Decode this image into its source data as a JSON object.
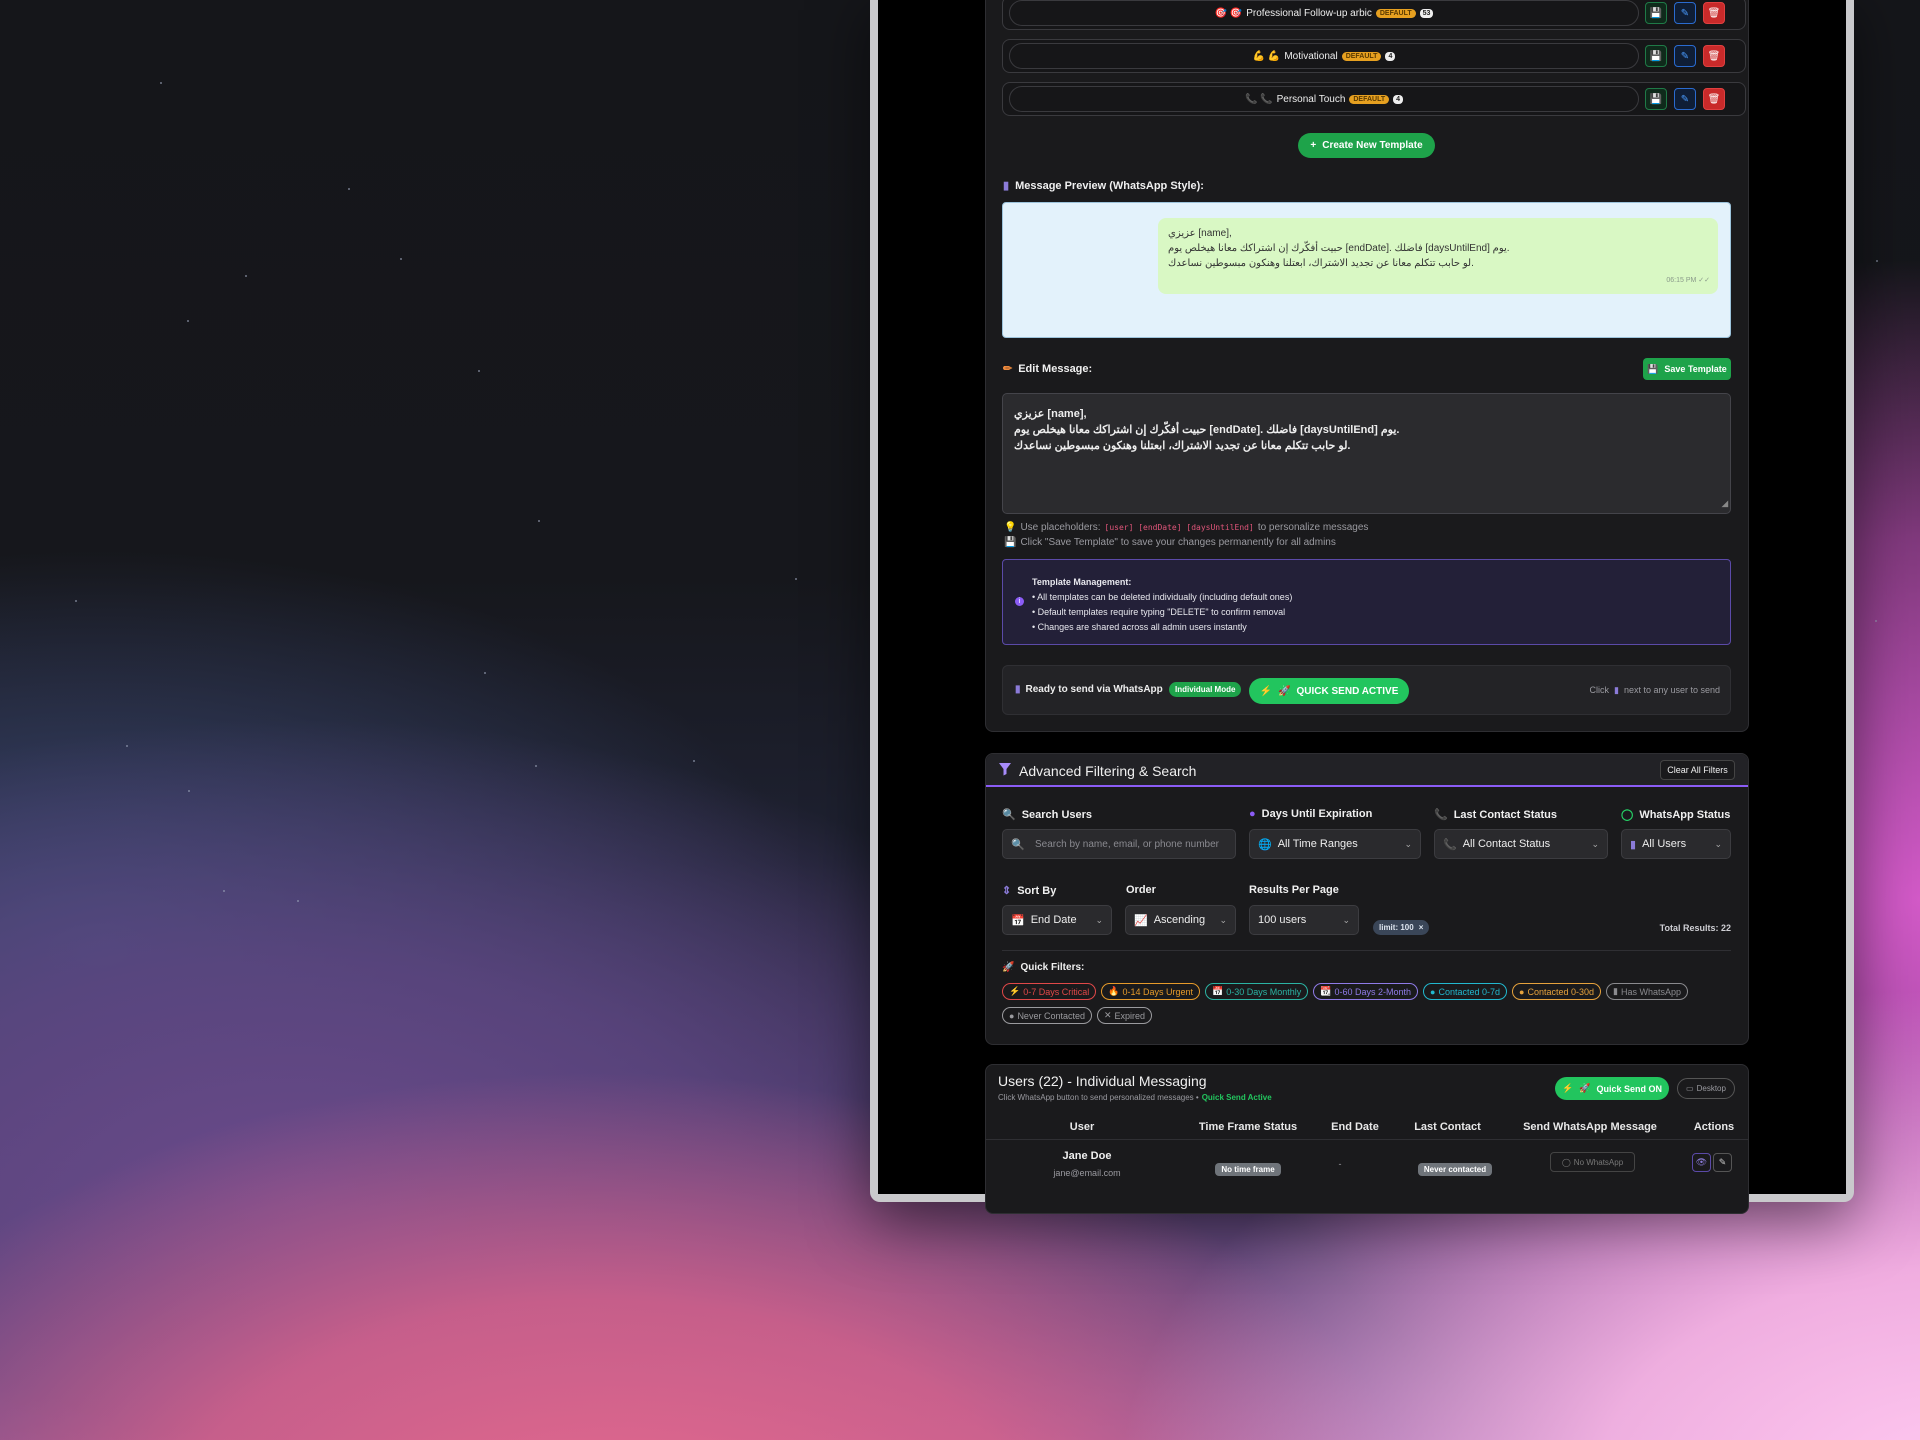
{
  "templates": [
    {
      "icon": "🎯 🎯",
      "name": "Professional Follow-up arbic",
      "badge": "DEFAULT",
      "count": "53"
    },
    {
      "icon": "💪 💪",
      "name": "Motivational",
      "badge": "DEFAULT",
      "count": "4"
    },
    {
      "icon": "📞 📞",
      "name": "Personal Touch",
      "badge": "DEFAULT",
      "count": "4"
    }
  ],
  "create_template_label": "Create New Template",
  "preview": {
    "heading": "Message Preview (WhatsApp Style):",
    "line1": "عزيزي [name],",
    "line2": "حبيت أفكّرك إن اشتراكك معانا هيخلص يوم [endDate]. فاضلك [daysUntilEnd] يوم.",
    "line3": "لو حابب تتكلم معانا عن تجديد الاشتراك، ابعتلنا وهنكون مبسوطين نساعدك.",
    "time": "06:15 PM ✓✓"
  },
  "edit": {
    "heading": "Edit Message:",
    "save_label": "Save Template",
    "line1": "عزيزي [name],",
    "line2": "حبيت أفكّرك إن اشتراكك معانا هيخلص يوم [endDate]. فاضلك [daysUntilEnd] يوم.",
    "line3": "لو حابب تتكلم معانا عن تجديد الاشتراك، ابعتلنا وهنكون مبسوطين نساعدك.",
    "hint1_pre": "Use placeholders:",
    "hint1_codes": "[user] [endDate] [daysUntilEnd]",
    "hint1_post": "to personalize messages",
    "hint2": "Click \"Save Template\" to save your changes permanently for all admins"
  },
  "management": {
    "title": "Template Management:",
    "items": [
      "• All templates can be deleted individually (including default ones)",
      "• Default templates require typing \"DELETE\" to confirm removal",
      "• Changes are shared across all admin users instantly"
    ]
  },
  "ready_bar": {
    "label": "Ready to send via WhatsApp",
    "mode": "Individual Mode",
    "quick_send": "QUICK SEND ACTIVE",
    "hint_pre": "Click",
    "hint_post": "next to any user to send"
  },
  "filter": {
    "title": "Advanced Filtering & Search",
    "clear": "Clear All Filters",
    "search_label": "Search Users",
    "search_placeholder": "Search by name, email, or phone number",
    "days_label": "Days Until Expiration",
    "days_value": "All Time Ranges",
    "contact_label": "Last Contact Status",
    "contact_value": "All Contact Status",
    "wa_label": "WhatsApp Status",
    "wa_value": "All Users",
    "sort_label": "Sort By",
    "sort_value": "End Date",
    "order_label": "Order",
    "order_value": "Ascending",
    "rpp_label": "Results Per Page",
    "rpp_value": "100 users",
    "limit_chip": "limit: 100",
    "total": "Total Results: 22",
    "quick_label": "Quick Filters:",
    "quick": [
      {
        "label": "0-7 Days Critical",
        "icon": "⚡",
        "color": "#e04848"
      },
      {
        "label": "0-14 Days Urgent",
        "icon": "🔥",
        "color": "#e69a2a"
      },
      {
        "label": "0-30 Days Monthly",
        "icon": "📅",
        "color": "#2bb3a3"
      },
      {
        "label": "0-60 Days 2-Month",
        "icon": "📆",
        "color": "#8f7be8"
      },
      {
        "label": "Contacted 0-7d",
        "icon": "●",
        "color": "#22b8cf"
      },
      {
        "label": "Contacted 0-30d",
        "icon": "●",
        "color": "#e6a23c"
      },
      {
        "label": "Has WhatsApp",
        "icon": "▮",
        "color": "#8a8a8e"
      },
      {
        "label": "Never Contacted",
        "icon": "●",
        "color": "#9a9a9e"
      },
      {
        "label": "Expired",
        "icon": "✕",
        "color": "#9a9a9e"
      }
    ]
  },
  "users": {
    "title": "Users (22) - Individual Messaging",
    "sub_pre": "Click WhatsApp button to send personalized messages •",
    "sub_active": "Quick Send Active",
    "quick_on": "Quick Send ON",
    "desktop": "Desktop",
    "headers": [
      "User",
      "Time Frame Status",
      "End Date",
      "Last Contact",
      "Send WhatsApp Message",
      "Actions"
    ],
    "rows": [
      {
        "name": "Jane Doe",
        "email": "jane@email.com",
        "time_frame": "No time frame",
        "end_date": "-",
        "last_contact": "Never contacted",
        "whatsapp": "No WhatsApp"
      }
    ]
  },
  "colors": {
    "accent": "#8b5cf6",
    "green": "#1ea34a",
    "danger": "#c92a2a",
    "info": "#2a6bd0"
  }
}
